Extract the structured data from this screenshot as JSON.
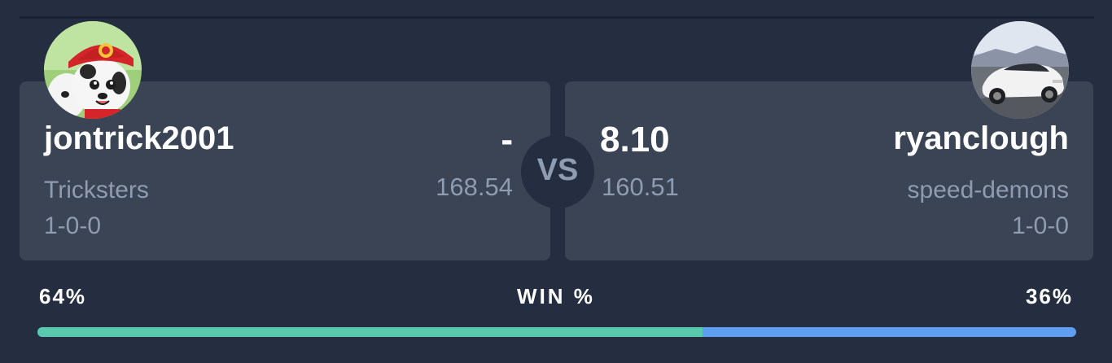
{
  "matchup": {
    "home": {
      "name": "jontrick2001",
      "score": "-",
      "projected": "168.54",
      "team": "Tricksters",
      "record": "1-0-0",
      "win_pct": "64%",
      "win_fraction": 0.64,
      "avatar": "dalmatian-pup-avatar"
    },
    "away": {
      "name": "ryanclough",
      "score": "8.10",
      "projected": "160.51",
      "team": "speed-demons",
      "record": "1-0-0",
      "win_pct": "36%",
      "avatar": "white-sports-car-avatar"
    },
    "vs_label": "VS",
    "win_label": "WIN %"
  },
  "colors": {
    "background": "#252e40",
    "card": "#3a4455",
    "home_bar": "#58c9ac",
    "away_bar": "#5f9ef0",
    "muted_text": "#8e9bb0"
  }
}
